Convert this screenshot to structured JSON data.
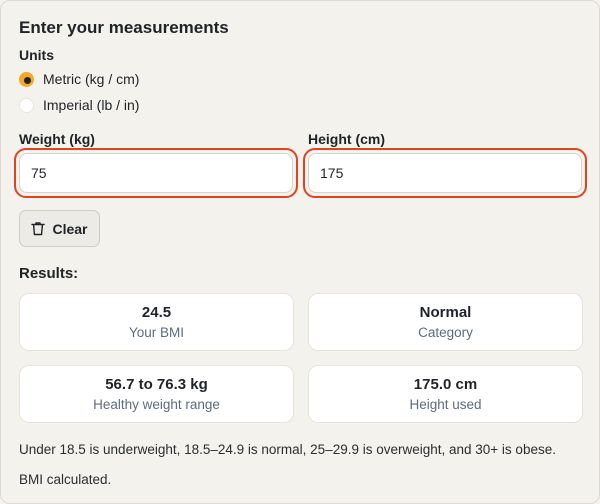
{
  "form": {
    "title": "Enter your measurements",
    "units_label": "Units",
    "unit_options": [
      {
        "label": "Metric (kg / cm)",
        "selected": true
      },
      {
        "label": "Imperial (lb / in)",
        "selected": false
      }
    ],
    "weight": {
      "label": "Weight (kg)",
      "value": "75"
    },
    "height": {
      "label": "Height (cm)",
      "value": "175"
    },
    "clear_label": "Clear",
    "clear_icon": "trash-icon"
  },
  "results": {
    "label": "Results:",
    "cards": [
      {
        "value": "24.5",
        "caption": "Your BMI"
      },
      {
        "value": "Normal",
        "caption": "Category"
      },
      {
        "value": "56.7 to 76.3 kg",
        "caption": "Healthy weight range"
      },
      {
        "value": "175.0 cm",
        "caption": "Height used"
      }
    ]
  },
  "note": "Under 18.5 is underweight, 18.5–24.9 is normal, 25–29.9 is overweight, and 30+ is obese.",
  "status": "BMI calculated.",
  "colors": {
    "background": "#f4f2ec",
    "accent_radio": "#f4a82a",
    "highlight_ring": "#e04322",
    "caption_text": "#5d6b82"
  }
}
